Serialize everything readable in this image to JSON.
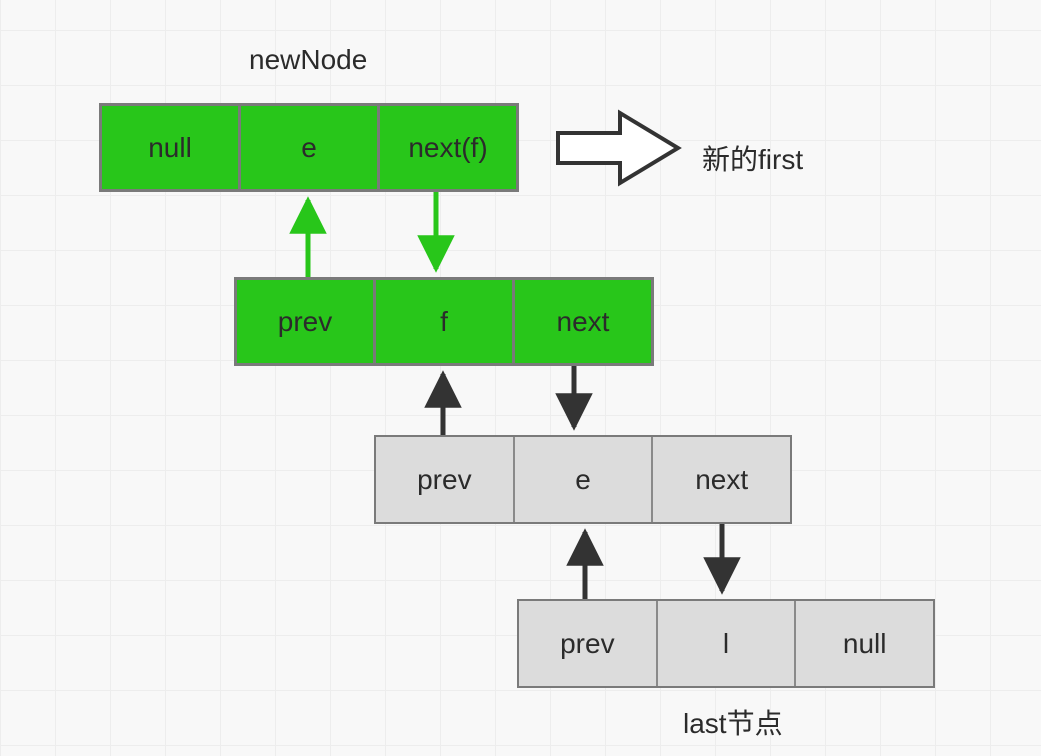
{
  "labels": {
    "newNode": "newNode",
    "newFirst": "新的first",
    "lastNode": "last节点"
  },
  "nodes": {
    "n1": {
      "prev": "null",
      "val": "e",
      "next": "next(f)"
    },
    "n2": {
      "prev": "prev",
      "val": "f",
      "next": "next"
    },
    "n3": {
      "prev": "prev",
      "val": "e",
      "next": "next"
    },
    "n4": {
      "prev": "prev",
      "val": "l",
      "next": "null"
    }
  }
}
